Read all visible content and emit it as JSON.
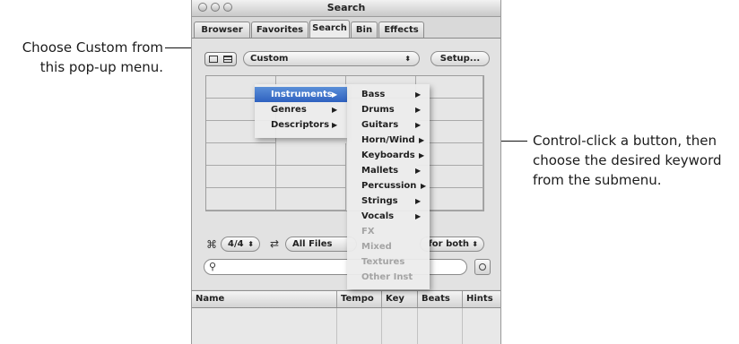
{
  "callouts": {
    "left": [
      "Choose Custom from",
      "this pop-up menu."
    ],
    "right": [
      "Control-click a button, then",
      "choose the desired keyword",
      "from the submenu."
    ]
  },
  "window": {
    "title": "Search",
    "tabs": [
      "Browser",
      "Favorites",
      "Search",
      "Bin",
      "Effects"
    ],
    "active_tab": "Search"
  },
  "toolbar": {
    "custom_popup": "Custom",
    "setup_button": "Setup..."
  },
  "category_menu": {
    "items": [
      {
        "label": "Instruments",
        "selected": true
      },
      {
        "label": "Genres",
        "selected": false
      },
      {
        "label": "Descriptors",
        "selected": false
      }
    ]
  },
  "submenu": {
    "items": [
      {
        "label": "Bass",
        "has_submenu": true,
        "disabled": false
      },
      {
        "label": "Drums",
        "has_submenu": true,
        "disabled": false
      },
      {
        "label": "Guitars",
        "has_submenu": true,
        "disabled": false
      },
      {
        "label": "Horn/Wind",
        "has_submenu": true,
        "disabled": false
      },
      {
        "label": "Keyboards",
        "has_submenu": true,
        "disabled": false
      },
      {
        "label": "Mallets",
        "has_submenu": true,
        "disabled": false
      },
      {
        "label": "Percussion",
        "has_submenu": true,
        "disabled": false
      },
      {
        "label": "Strings",
        "has_submenu": true,
        "disabled": false
      },
      {
        "label": "Vocals",
        "has_submenu": true,
        "disabled": false
      },
      {
        "label": "FX",
        "has_submenu": false,
        "disabled": true
      },
      {
        "label": "Mixed",
        "has_submenu": false,
        "disabled": true
      },
      {
        "label": "Textures",
        "has_submenu": false,
        "disabled": true
      },
      {
        "label": "Other Inst",
        "has_submenu": false,
        "disabled": true
      }
    ]
  },
  "controls": {
    "signature": "4/4",
    "scale": "All Files",
    "good_for": "for both",
    "search_placeholder": ""
  },
  "table": {
    "columns": [
      "Name",
      "Tempo",
      "Key",
      "Beats",
      "Hints"
    ]
  },
  "colors": {
    "selection": "#2e61c0",
    "disabled_text": "#a4a4a4"
  }
}
